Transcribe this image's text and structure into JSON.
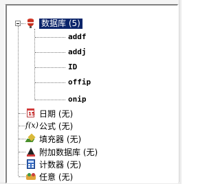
{
  "tree": {
    "root": {
      "label": "数据库 (5)",
      "icon": "database-icon",
      "expanded": true,
      "selected": true,
      "children": [
        "addf",
        "addj",
        "ID",
        "offip",
        "onip"
      ]
    },
    "nodes": [
      {
        "label": "日期 (无)",
        "icon": "calendar-icon"
      },
      {
        "label": "公式 (无)",
        "icon": "formula-icon",
        "glyph": "f(x)"
      },
      {
        "label": "填充器 (无)",
        "icon": "filler-icon"
      },
      {
        "label": "附加数据库 (无)",
        "icon": "attach-database-icon"
      },
      {
        "label": "计数器 (无)",
        "icon": "counter-icon"
      },
      {
        "label": "任意 (无)",
        "icon": "random-icon"
      }
    ]
  },
  "colors": {
    "selection_bg": "#0a246a",
    "selection_fg": "#ffffff"
  }
}
